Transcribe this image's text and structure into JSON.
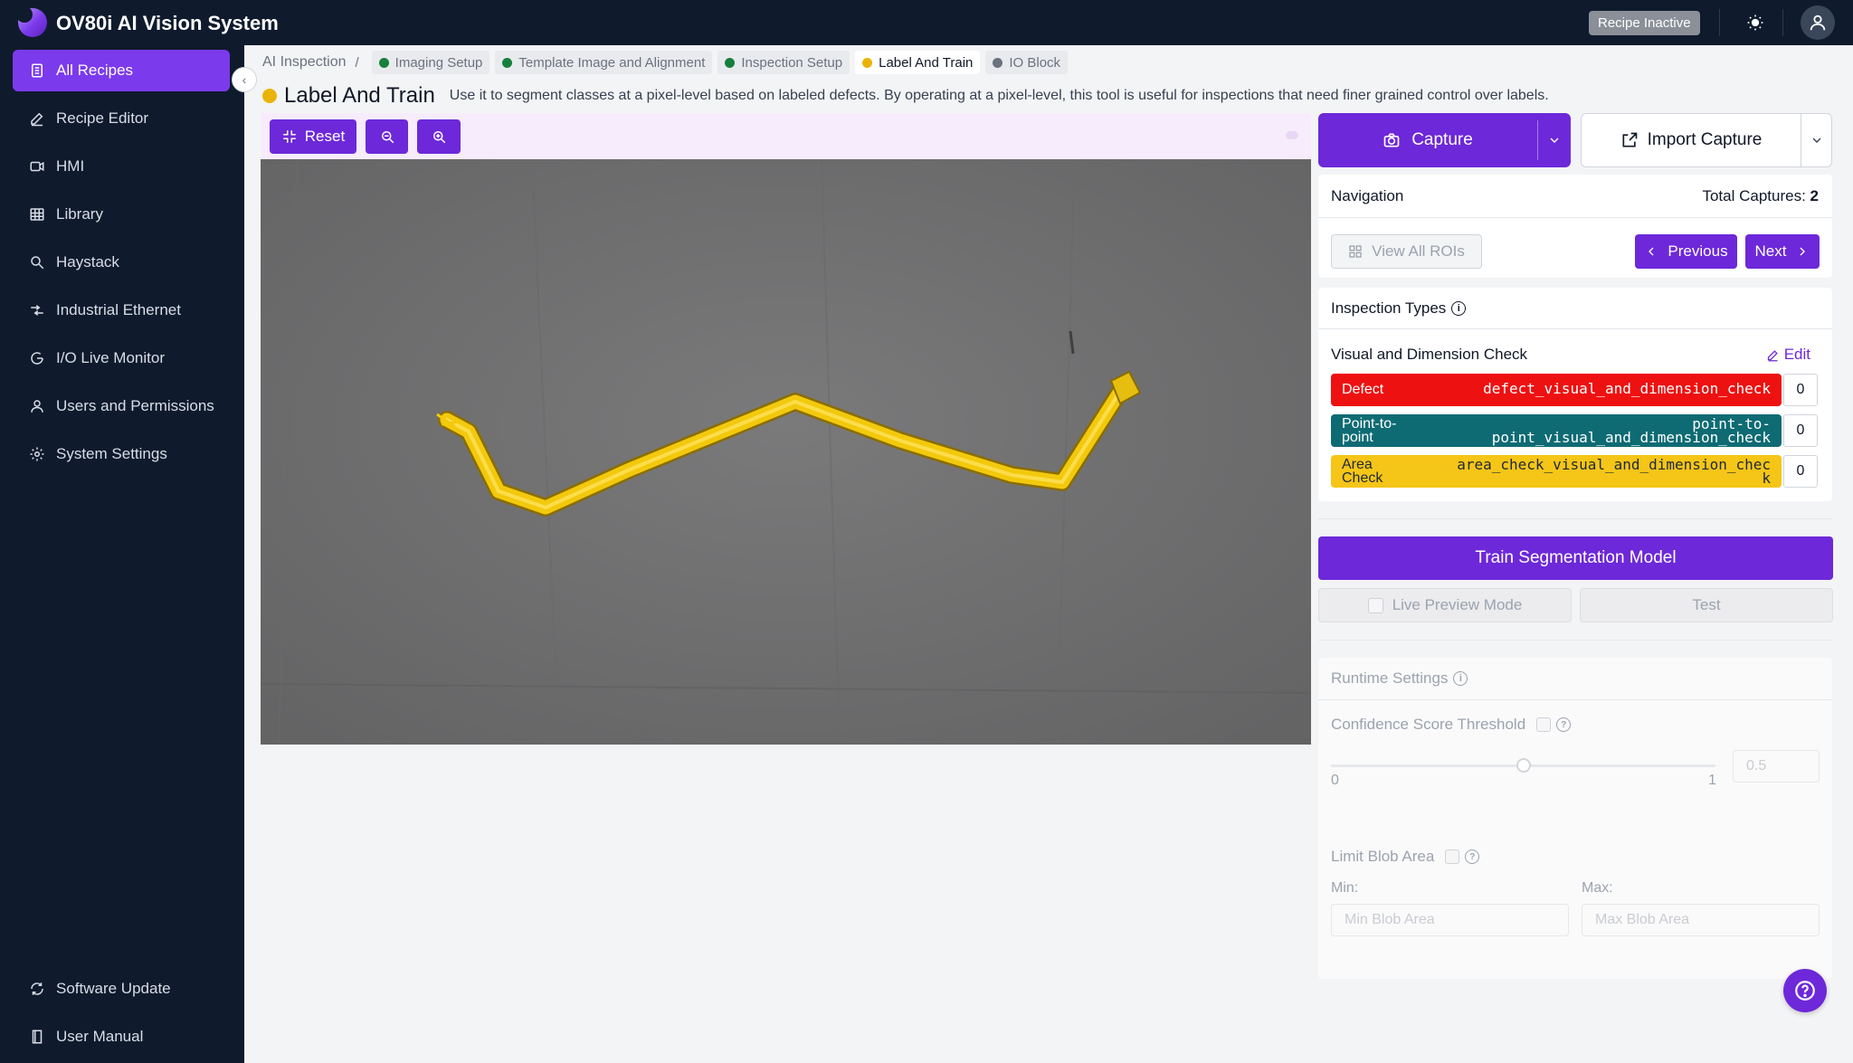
{
  "app": {
    "title": "OV80i AI Vision System",
    "recipe_status": "Recipe Inactive"
  },
  "sidebar": {
    "items": [
      {
        "label": "All Recipes",
        "icon": "document-icon",
        "active": true
      },
      {
        "label": "Recipe Editor",
        "icon": "pencil-icon"
      },
      {
        "label": "HMI",
        "icon": "video-icon"
      },
      {
        "label": "Library",
        "icon": "table-icon"
      },
      {
        "label": "Haystack",
        "icon": "search-icon"
      },
      {
        "label": "Industrial Ethernet",
        "icon": "ethernet-icon"
      },
      {
        "label": "I/O Live Monitor",
        "icon": "monitor-icon"
      },
      {
        "label": "Users and Permissions",
        "icon": "user-icon"
      },
      {
        "label": "System Settings",
        "icon": "gear-icon"
      }
    ],
    "footer": [
      {
        "label": "Software Update",
        "icon": "refresh-icon"
      },
      {
        "label": "User Manual",
        "icon": "book-icon"
      }
    ]
  },
  "breadcrumb": {
    "root": "AI Inspection",
    "separator": "/",
    "steps": [
      {
        "label": "Imaging Setup",
        "color": "#15803d"
      },
      {
        "label": "Template Image and Alignment",
        "color": "#15803d"
      },
      {
        "label": "Inspection Setup",
        "color": "#15803d"
      },
      {
        "label": "Label And Train",
        "color": "#eab308",
        "active": true
      },
      {
        "label": "IO Block",
        "color": "#6b7280"
      }
    ]
  },
  "page": {
    "title": "Label And Train",
    "description": "Use it to segment classes at a pixel-level based on labeled defects. By operating at a pixel-level, this tool is useful for inspections that need finer grained control over labels."
  },
  "toolbar": {
    "reset_label": "Reset",
    "zoom_out": "zoom-out-icon",
    "zoom_in": "zoom-in-icon"
  },
  "capture": {
    "capture_label": "Capture",
    "import_label": "Import Capture"
  },
  "navigation": {
    "heading": "Navigation",
    "total_label": "Total Captures:",
    "total_value": "2",
    "view_all_label": "View All ROIs",
    "previous_label": "Previous",
    "next_label": "Next"
  },
  "inspection_types": {
    "heading": "Inspection Types",
    "group_name": "Visual and Dimension Check",
    "edit_label": "Edit",
    "classes": [
      {
        "name": "Defect",
        "id": "defect_visual_and_dimension_check",
        "count": "0",
        "color": "#ee1111",
        "text_color": "#ffffff"
      },
      {
        "name": "Point-to-\npoint",
        "id": "point-to-\npoint_visual_and_dimension_check",
        "count": "0",
        "color": "#0e6b73",
        "text_color": "#ffffff"
      },
      {
        "name": "Area\nCheck",
        "id": "area_check_visual_and_dimension_chec\nk",
        "count": "0",
        "color": "#f5c518",
        "text_color": "#1f2937"
      }
    ]
  },
  "training": {
    "train_label": "Train Segmentation Model",
    "live_preview_label": "Live Preview Mode",
    "test_label": "Test"
  },
  "runtime": {
    "heading": "Runtime Settings",
    "confidence_label": "Confidence Score Threshold",
    "slider_min": "0",
    "slider_max": "1",
    "confidence_value": "0.5",
    "confidence_fraction": 0.5,
    "blob_label": "Limit Blob Area",
    "min_label": "Min:",
    "max_label": "Max:",
    "min_placeholder": "Min Blob Area",
    "max_placeholder": "Max Blob Area"
  }
}
